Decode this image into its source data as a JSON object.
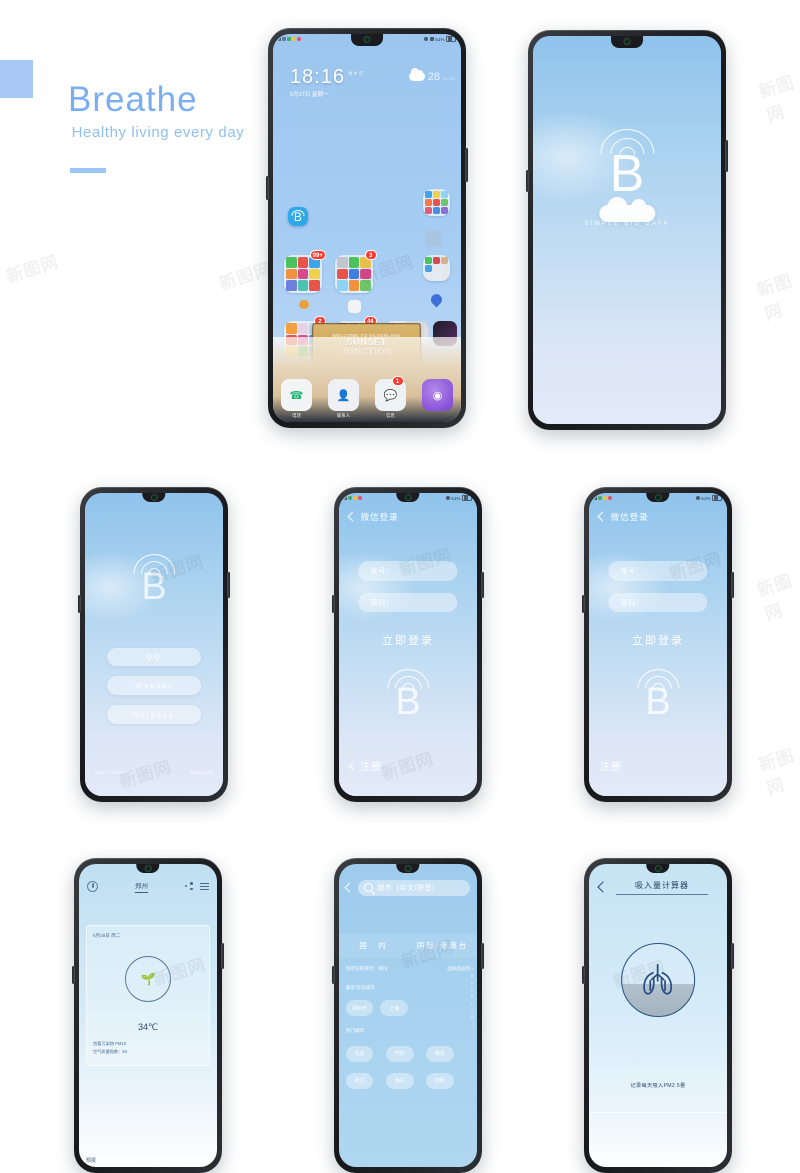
{
  "hero": {
    "title": "Breathe",
    "subtitle": "Healthy living every day",
    "accent_color": "#7aaef0",
    "swatch_color": "#a8c9f5"
  },
  "watermark": "新图网",
  "phone_home": {
    "status": {
      "battery": "51%",
      "icons": [
        "signal-icon",
        "wifi-icon",
        "app-notification-icon",
        "emoji-icon",
        "record-icon"
      ],
      "right_icons": [
        "vibrate-icon",
        "shield-icon",
        "battery-icon"
      ]
    },
    "clock": {
      "time": "18:16",
      "location": "金水区",
      "date": "5月27日 星期一"
    },
    "weather": {
      "temp": "28",
      "range": "20 / 31",
      "icon": "cloud-icon"
    },
    "app_icon_label": "B",
    "folders": [
      {
        "badge": "99+"
      },
      {
        "badge": "3"
      },
      {
        "badge": "2"
      },
      {
        "badge": "44"
      }
    ],
    "sign": {
      "line1": "WELCOME TO SILVERLAKE",
      "line2": "SUNSET",
      "line3": "JUNCTION"
    },
    "dock": [
      {
        "label": "电话",
        "icon": "phone-icon",
        "badge": ""
      },
      {
        "label": "联系人",
        "icon": "contacts-icon",
        "badge": ""
      },
      {
        "label": "信息",
        "icon": "messages-icon",
        "badge": "1"
      },
      {
        "label": "",
        "icon": "browser-icon",
        "badge": ""
      }
    ]
  },
  "phone_splash": {
    "logo_letter": "B",
    "tagline": "SIMPLE BIG DATA"
  },
  "phone_social_login": {
    "logo_letter": "B",
    "buttons": [
      {
        "label": "QQ"
      },
      {
        "label": "Wechat"
      },
      {
        "label": "Netease"
      }
    ],
    "footer_left": "User Account",
    "footer_right": "Need Help"
  },
  "phone_login_a": {
    "status": {
      "battery": "51%"
    },
    "nav_title": "微信登录",
    "fields": [
      {
        "label": "账号：",
        "value": ""
      },
      {
        "label": "密码：",
        "value": ""
      }
    ],
    "submit": "立即登录",
    "logo_letter": "B",
    "register": "注册"
  },
  "phone_login_b": {
    "status": {
      "battery": "51%"
    },
    "nav_title": "微信登录",
    "fields": [
      {
        "label": "帐号：",
        "value": ""
      },
      {
        "label": "密码：",
        "value": ""
      }
    ],
    "submit": "立即登录",
    "logo_letter": "B",
    "register": "注册"
  },
  "phone_weather": {
    "city": "郑州",
    "date_line": "5月28日 周二",
    "quality_icon": "sprout-icon",
    "temperature": "34℃",
    "detail_line1": "首要污染物 PM10",
    "detail_line2": "空气质量指数：84",
    "forecast_label": "预报",
    "actions": [
      "lock-icon",
      "share-icon",
      "menu-icon"
    ]
  },
  "phone_city": {
    "search_placeholder": "城市（中文/拼音）",
    "tabs": [
      "国　内",
      "国际/港澳台"
    ],
    "located_label": "您所在的城市：郑州",
    "located_action": "选择后返回",
    "recent_label": "最近/常去城市",
    "recent_chips": [
      "郑州市",
      "上海"
    ],
    "hot_label": "热门城市",
    "hot_chips": [
      "北京",
      "开封",
      "南京",
      "武汉",
      "海口",
      "济南"
    ],
    "index_letters": [
      "A",
      "B",
      "C",
      "D",
      "E",
      "F",
      "G",
      "H",
      "J"
    ]
  },
  "phone_inhale": {
    "title": "吸入量计算器",
    "icon": "lungs-icon",
    "caption": "记录每天吸入PM2.5量"
  }
}
